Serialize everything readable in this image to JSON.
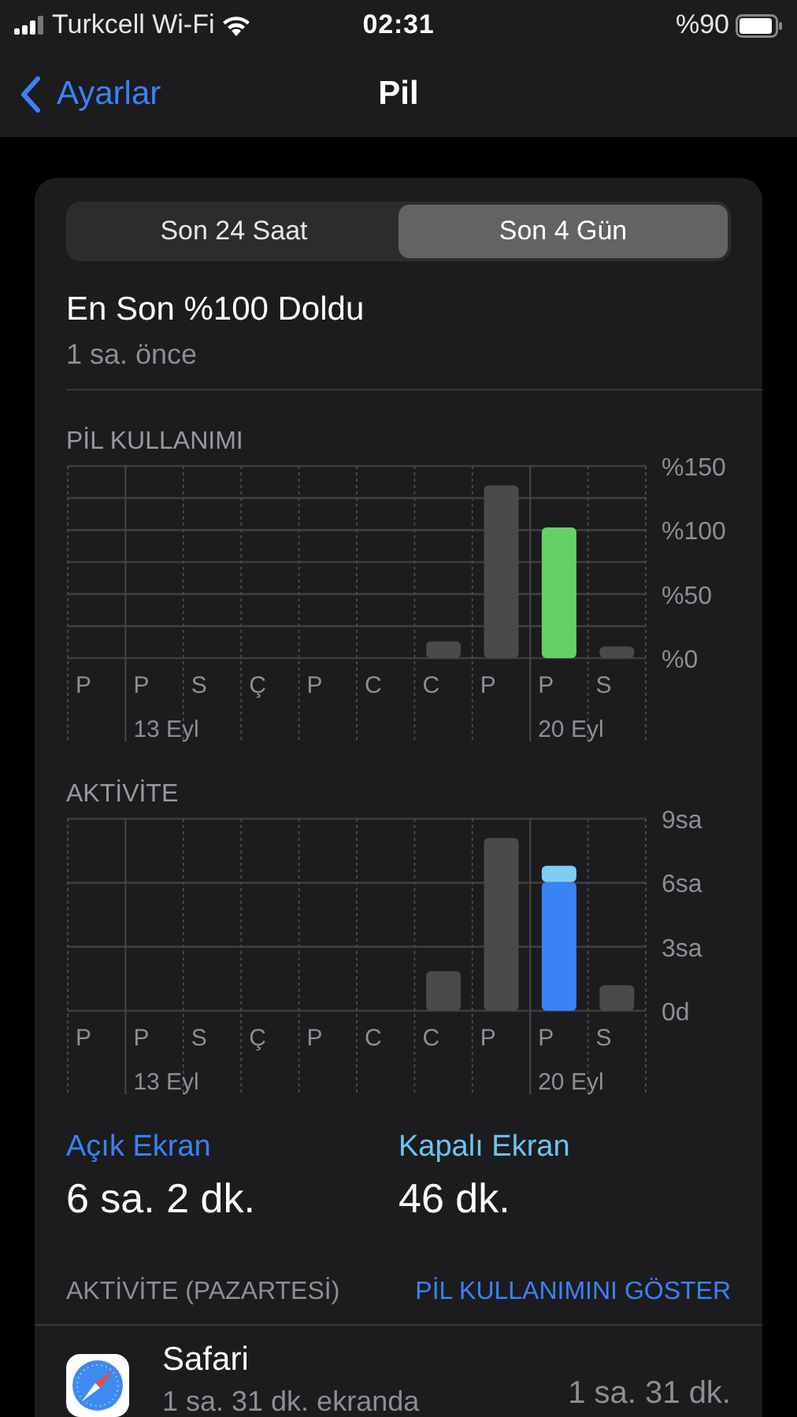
{
  "status_bar": {
    "carrier": "Turkcell Wi-Fi",
    "time": "02:31",
    "battery": "%90"
  },
  "nav": {
    "back": "Ayarlar",
    "title": "Pil"
  },
  "segments": [
    {
      "label": "Son 24 Saat",
      "selected": false
    },
    {
      "label": "Son 4 Gün",
      "selected": true
    }
  ],
  "last_charge": {
    "title": "En Son %100 Doldu",
    "subtitle": "1 sa. önce"
  },
  "charts": [
    {
      "title": "PİL KULLANIMI",
      "weeks": [
        "13 Eyl",
        "20 Eyl"
      ],
      "chart_data": {
        "type": "bar",
        "stacked": true,
        "categories": [
          "P",
          "P",
          "S",
          "Ç",
          "P",
          "C",
          "C",
          "P",
          "P",
          "S"
        ],
        "ylim": [
          0,
          150
        ],
        "yticks": [
          {
            "value": 0,
            "label": "%0"
          },
          {
            "value": 50,
            "label": "%50"
          },
          {
            "value": 100,
            "label": "%100"
          },
          {
            "value": 150,
            "label": "%150"
          }
        ],
        "series": [
          {
            "color": "#4a4a4c",
            "values": [
              0,
              0,
              0,
              0,
              0,
              0,
              13,
              135,
              null,
              9
            ]
          },
          {
            "color": "#65d065",
            "values": [
              null,
              null,
              null,
              null,
              null,
              null,
              null,
              null,
              102,
              null
            ]
          }
        ]
      }
    },
    {
      "title": "AKTİVİTE",
      "weeks": [
        "13 Eyl",
        "20 Eyl"
      ],
      "chart_data": {
        "type": "bar",
        "stacked": true,
        "categories": [
          "P",
          "P",
          "S",
          "Ç",
          "P",
          "C",
          "C",
          "P",
          "P",
          "S"
        ],
        "ylim": [
          0,
          9
        ],
        "yticks": [
          {
            "value": 0,
            "label": "0d"
          },
          {
            "value": 3,
            "label": "3sa"
          },
          {
            "value": 6,
            "label": "6sa"
          },
          {
            "value": 9,
            "label": "9sa"
          }
        ],
        "series": [
          {
            "color": "#4a4a4c",
            "values": [
              0,
              0,
              0,
              0,
              0,
              0,
              1.85,
              8.1,
              null,
              1.2
            ]
          },
          {
            "color": "#3a82f6",
            "values": [
              null,
              null,
              null,
              null,
              null,
              null,
              null,
              null,
              6.03,
              null
            ]
          },
          {
            "color": "#7fcdf5",
            "values": [
              null,
              null,
              null,
              null,
              null,
              null,
              null,
              null,
              0.77,
              null
            ]
          }
        ]
      }
    }
  ],
  "screen_stats": [
    {
      "label": "Açık Ekran",
      "value": "6 sa. 2 dk.",
      "color": "#3a82f6"
    },
    {
      "label": "Kapalı Ekran",
      "value": "46 dk.",
      "color": "#6cc5f0"
    }
  ],
  "activity": {
    "header": "AKTİVİTE (PAZARTESİ)",
    "link": "PİL KULLANIMINI GÖSTER",
    "apps": [
      {
        "name": "Safari",
        "detail": "1 sa. 31 dk. ekranda",
        "time": "1 sa. 31 dk."
      }
    ]
  }
}
